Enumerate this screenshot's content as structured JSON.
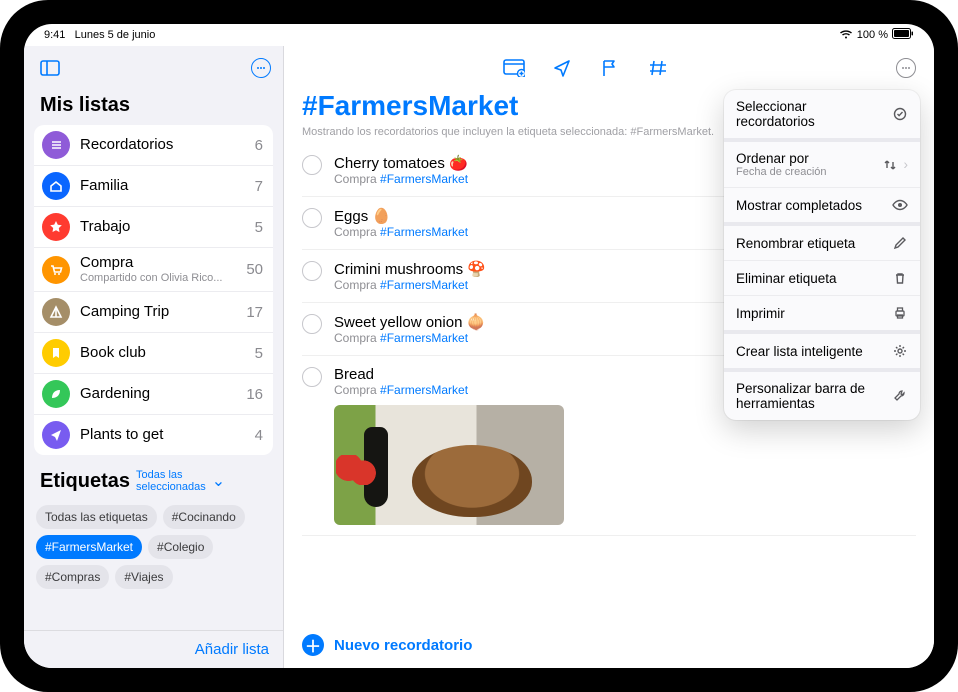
{
  "statusbar": {
    "time": "9:41",
    "date": "Lunes 5 de junio",
    "battery": "100 %"
  },
  "sidebar": {
    "title": "Mis listas",
    "add_list_label": "Añadir lista",
    "tags_title": "Etiquetas",
    "tags_filter": "Todas las\nseleccionadas",
    "lists": [
      {
        "icon": "list-icon",
        "name": "Recordatorios",
        "count": "6",
        "color": "#8f5bd8"
      },
      {
        "icon": "house-icon",
        "name": "Familia",
        "count": "7",
        "color": "#0a66ff"
      },
      {
        "icon": "star-icon",
        "name": "Trabajo",
        "count": "5",
        "color": "#ff3b30"
      },
      {
        "icon": "cart-icon",
        "name": "Compra",
        "sub": "Compartido con Olivia Rico...",
        "count": "50",
        "color": "#ff9500"
      },
      {
        "icon": "tent-icon",
        "name": "Camping Trip",
        "count": "17",
        "color": "#a58e68"
      },
      {
        "icon": "bookmark-icon",
        "name": "Book club",
        "count": "5",
        "color": "#ffcc00"
      },
      {
        "icon": "leaf-icon",
        "name": "Gardening",
        "count": "16",
        "color": "#34c759"
      },
      {
        "icon": "paper-plane-icon",
        "name": "Plants to get",
        "count": "4",
        "color": "#785cf0"
      }
    ],
    "tags": [
      {
        "label": "Todas las etiquetas",
        "selected": false
      },
      {
        "label": "#Cocinando",
        "selected": false
      },
      {
        "label": "#FarmersMarket",
        "selected": true
      },
      {
        "label": "#Colegio",
        "selected": false
      },
      {
        "label": "#Compras",
        "selected": false
      },
      {
        "label": "#Viajes",
        "selected": false
      }
    ]
  },
  "main": {
    "title": "#FarmersMarket",
    "subtitle": "Mostrando los recordatorios que incluyen la etiqueta seleccionada: #FarmersMarket.",
    "new_reminder_label": "Nuevo recordatorio",
    "list_link_label": "Compra",
    "tag_link_label": "#FarmersMarket",
    "items": [
      {
        "title": "Cherry tomatoes 🍅"
      },
      {
        "title": "Eggs 🥚"
      },
      {
        "title": "Crimini mushrooms 🍄"
      },
      {
        "title": "Sweet yellow onion 🧅"
      },
      {
        "title": "Bread",
        "has_image": true
      }
    ]
  },
  "menu": [
    {
      "label": "Seleccionar recordatorios",
      "icon": "select-icon"
    },
    {
      "separator": true
    },
    {
      "label": "Ordenar por",
      "sub": "Fecha de creación",
      "icon": "sort-icon",
      "chevron": true
    },
    {
      "label": "Mostrar completados",
      "icon": "eye-icon"
    },
    {
      "separator": true
    },
    {
      "label": "Renombrar etiqueta",
      "icon": "pencil-icon"
    },
    {
      "label": "Eliminar etiqueta",
      "icon": "trash-icon"
    },
    {
      "label": "Imprimir",
      "icon": "print-icon"
    },
    {
      "separator": true
    },
    {
      "label": "Crear lista inteligente",
      "icon": "gear-icon"
    },
    {
      "separator": true
    },
    {
      "label": "Personalizar barra de herramientas",
      "icon": "wrench-icon"
    }
  ]
}
